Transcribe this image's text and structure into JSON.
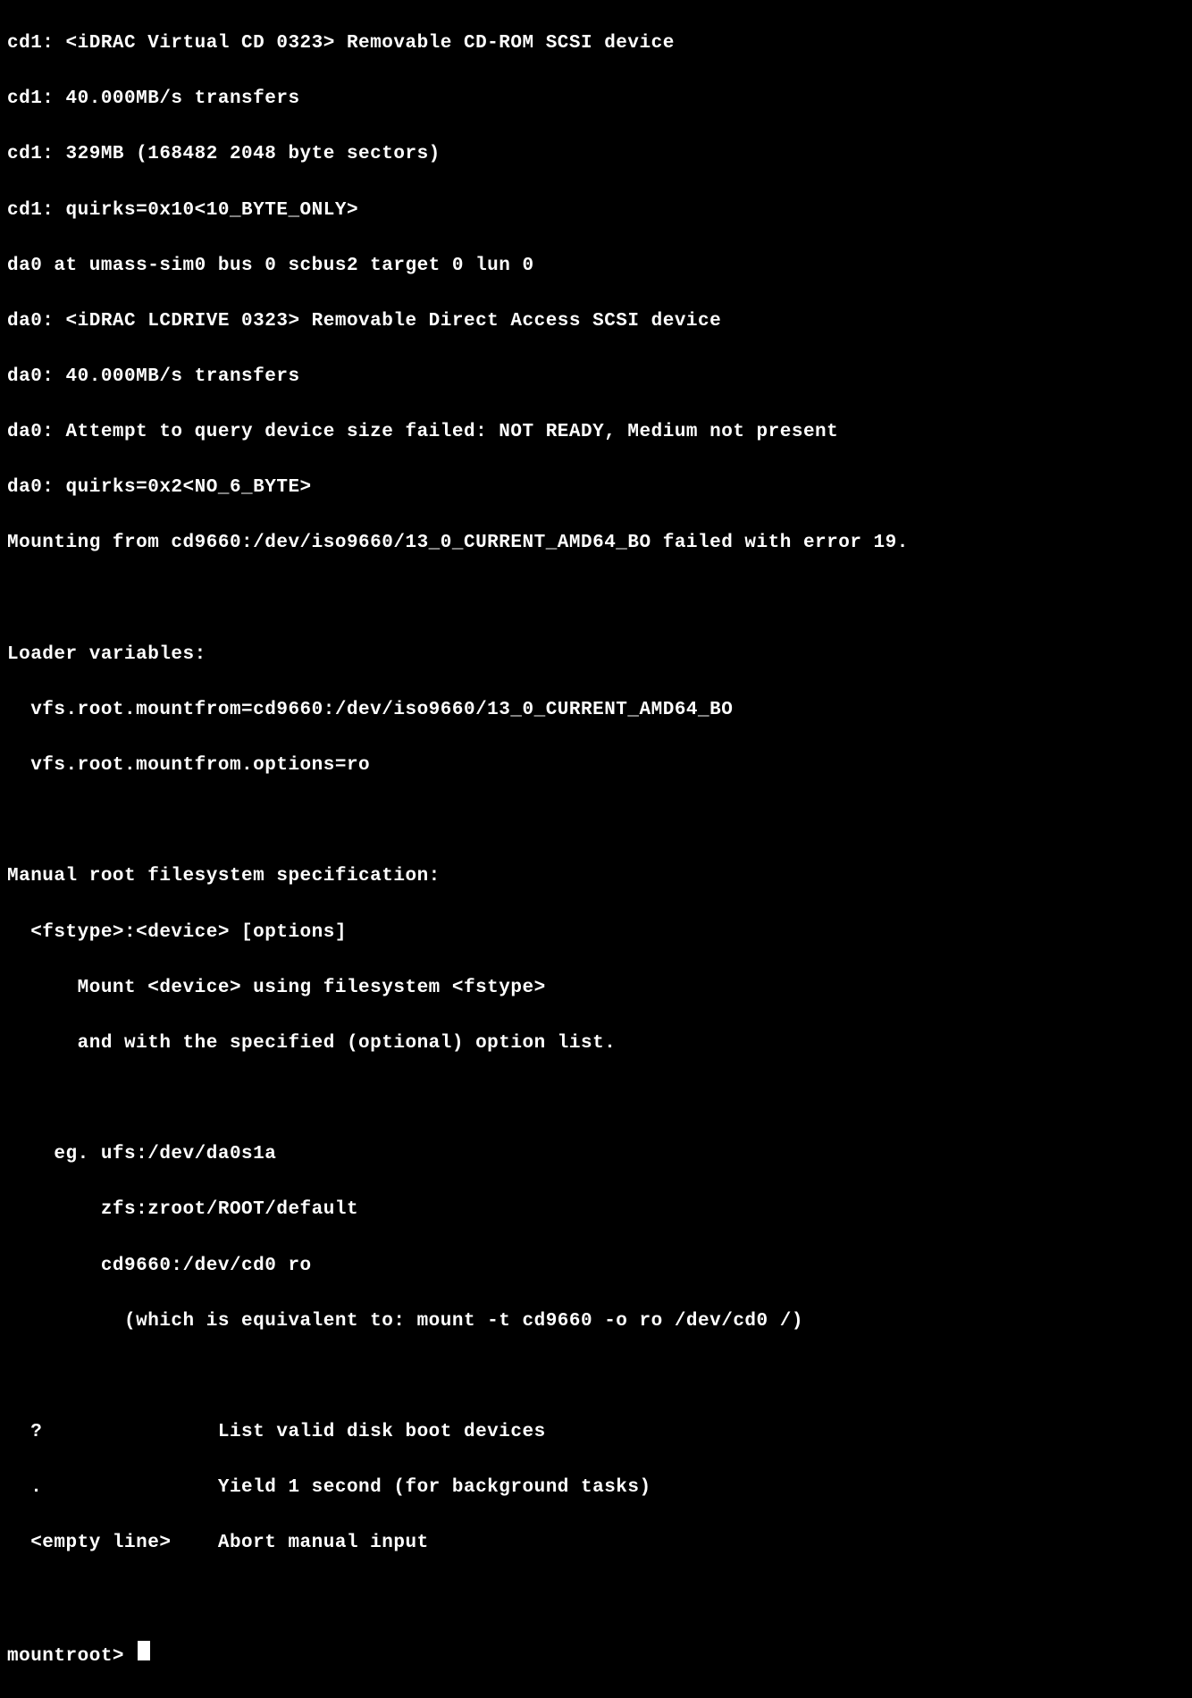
{
  "boot_messages": [
    "cd1: <iDRAC Virtual CD 0323> Removable CD-ROM SCSI device",
    "cd1: 40.000MB/s transfers",
    "cd1: 329MB (168482 2048 byte sectors)",
    "cd1: quirks=0x10<10_BYTE_ONLY>",
    "da0 at umass-sim0 bus 0 scbus2 target 0 lun 0",
    "da0: <iDRAC LCDRIVE 0323> Removable Direct Access SCSI device",
    "da0: 40.000MB/s transfers",
    "da0: Attempt to query device size failed: NOT READY, Medium not present",
    "da0: quirks=0x2<NO_6_BYTE>",
    "Mounting from cd9660:/dev/iso9660/13_0_CURRENT_AMD64_BO failed with error 19."
  ],
  "loader_section": {
    "header": "Loader variables:",
    "vars": [
      "  vfs.root.mountfrom=cd9660:/dev/iso9660/13_0_CURRENT_AMD64_BO",
      "  vfs.root.mountfrom.options=ro"
    ]
  },
  "manual_section": {
    "header": "Manual root filesystem specification:",
    "spec": [
      "  <fstype>:<device> [options]",
      "      Mount <device> using filesystem <fstype>",
      "      and with the specified (optional) option list."
    ],
    "examples": [
      "    eg. ufs:/dev/da0s1a",
      "        zfs:zroot/ROOT/default",
      "        cd9660:/dev/cd0 ro",
      "          (which is equivalent to: mount -t cd9660 -o ro /dev/cd0 /)"
    ],
    "commands": [
      "  ?               List valid disk boot devices",
      "  .               Yield 1 second (for background tasks)",
      "  <empty line>    Abort manual input"
    ]
  },
  "prompt": "mountroot> "
}
